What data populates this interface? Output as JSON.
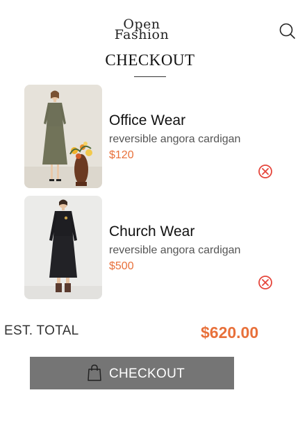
{
  "header": {
    "logo_line1": "Open",
    "logo_line2": "Fashion",
    "search_icon": "search-icon"
  },
  "page": {
    "title": "CHECKOUT"
  },
  "cart": {
    "items": [
      {
        "name": "Office Wear",
        "description": "reversible angora cardigan",
        "price": "$120",
        "image": "model-in-olive-dress-photo"
      },
      {
        "name": "Church Wear",
        "description": "reversible angora cardigan",
        "price": "$500",
        "image": "model-in-black-dress-photo"
      }
    ],
    "remove_icon": "close-circle-icon"
  },
  "summary": {
    "total_label": "EST. TOTAL",
    "total_value": "$620.00"
  },
  "checkout_button": {
    "label": "CHECKOUT",
    "icon": "shopping-bag-icon"
  },
  "colors": {
    "accent": "#e8703a",
    "remove": "#e5463c",
    "button": "#757575"
  }
}
